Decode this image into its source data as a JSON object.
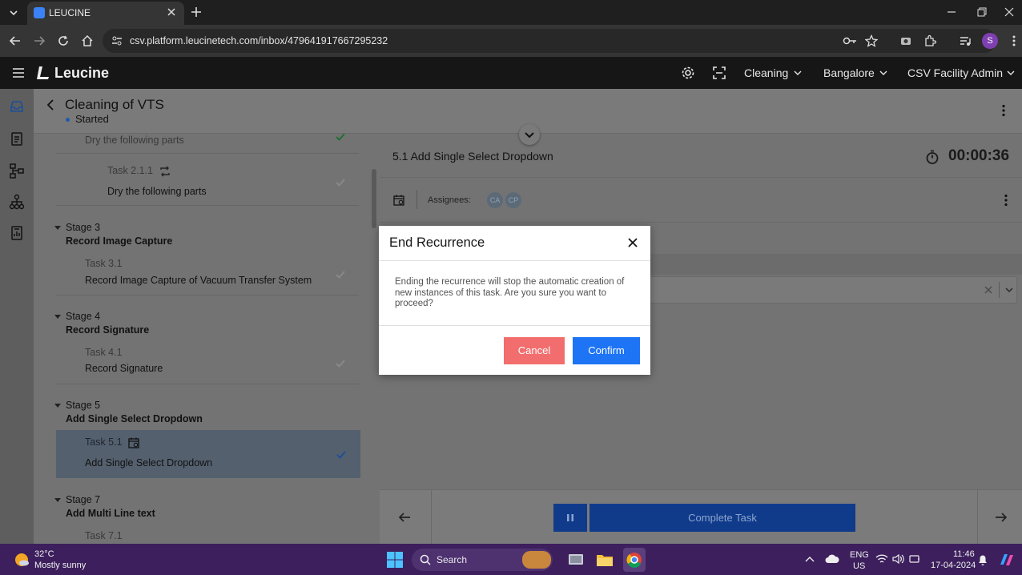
{
  "browser": {
    "tab_title": "LEUCINE",
    "url": "csv.platform.leucinetech.com/inbox/479641917667295232"
  },
  "app": {
    "brand": "Leucine",
    "use_case": "Cleaning",
    "facility": "Bangalore",
    "role": "CSV Facility Admin"
  },
  "job": {
    "title": "Cleaning of VTS",
    "status": "Started"
  },
  "stages": {
    "partial_task_name": "Dry the following parts",
    "task_2_1_1": {
      "label": "Task 2.1.1",
      "name": "Dry the following parts"
    },
    "stage3": {
      "label": "Stage 3",
      "name": "Record Image Capture",
      "task_label": "Task 3.1",
      "task_name": "Record Image Capture of Vacuum Transfer System"
    },
    "stage4": {
      "label": "Stage 4",
      "name": "Record Signature",
      "task_label": "Task 4.1",
      "task_name": "Record Signature"
    },
    "stage5": {
      "label": "Stage 5",
      "name": "Add Single Select Dropdown",
      "task_label": "Task 5.1",
      "task_name": "Add Single Select Dropdown"
    },
    "stage7": {
      "label": "Stage 7",
      "name": "Add Multi Line text",
      "task_label": "Task 7.1"
    }
  },
  "task_panel": {
    "title": "5.1 Add Single Select Dropdown",
    "timer": "00:00:36",
    "assignees_label": "Assignees:",
    "assignees": [
      "CA",
      "CP"
    ],
    "complete_label": "Complete Task"
  },
  "modal": {
    "title": "End Recurrence",
    "message": "Ending the recurrence will stop the automatic creation of new instances of this task. Are you sure you want to proceed?",
    "cancel_label": "Cancel",
    "confirm_label": "Confirm"
  },
  "taskbar": {
    "temperature": "32°C",
    "weather": "Mostly sunny",
    "search_placeholder": "Search",
    "lang_1": "ENG",
    "lang_2": "US",
    "time": "11:46",
    "date": "17-04-2024"
  },
  "colors": {
    "confirm": "#1d74f5",
    "cancel": "#f26e6e",
    "taskbar": "#3c1f5c"
  }
}
